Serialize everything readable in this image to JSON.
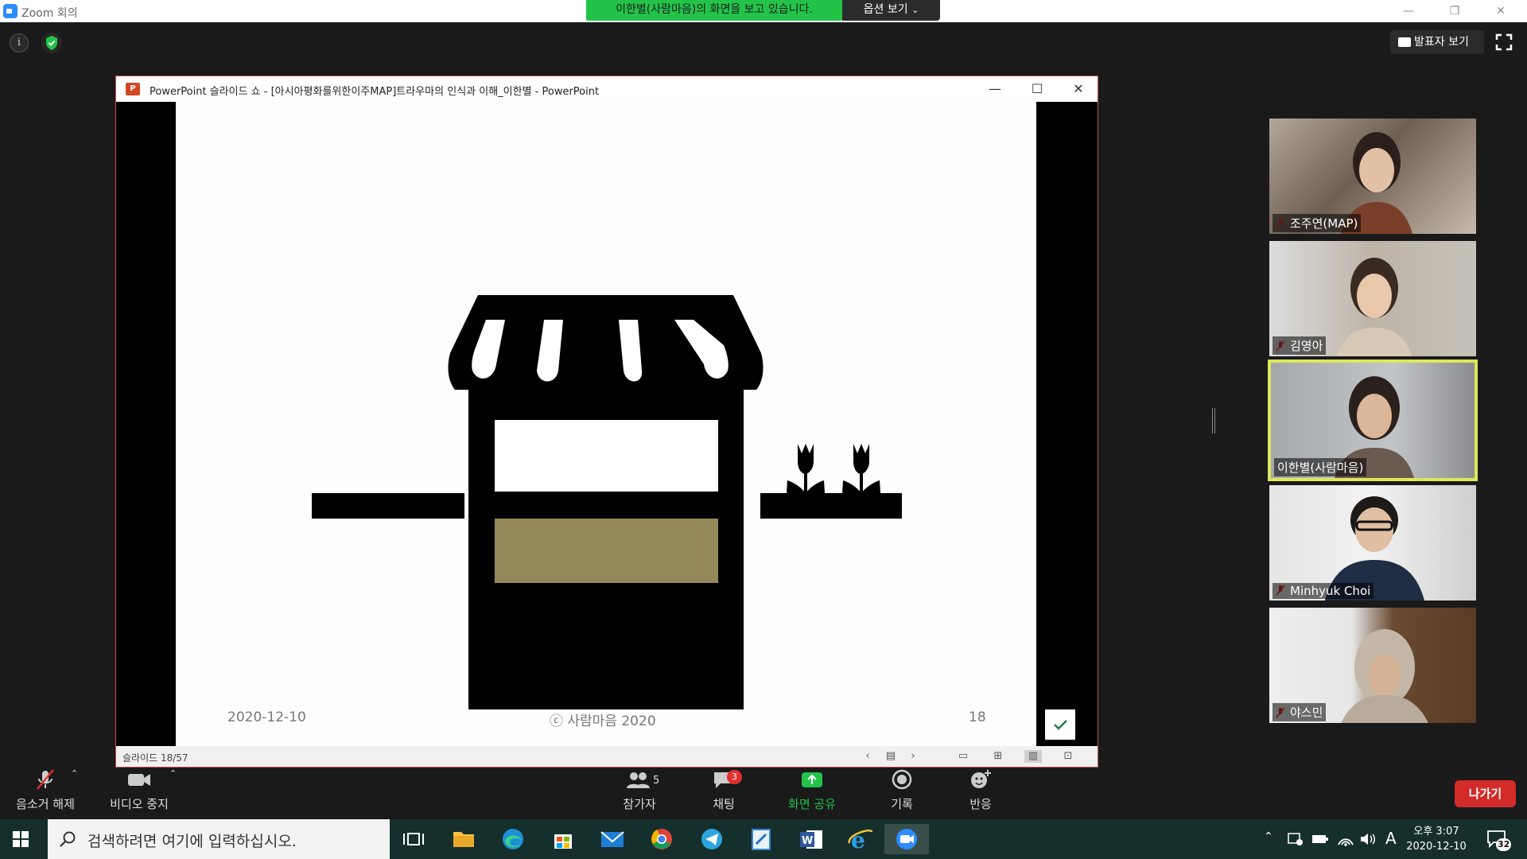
{
  "window": {
    "title": "Zoom 회의"
  },
  "share_banner": {
    "text": "이한별(사람마음)의 화면을 보고 있습니다.",
    "options_label": "옵션 보기"
  },
  "speaker_view": {
    "label": "발표자 보기"
  },
  "ppt": {
    "title": "PowerPoint 슬라이드 쇼  -  [아시아평화를위한이주MAP]트라우마의 인식과 이해_이한별 - PowerPoint",
    "status": "슬라이드 18/57",
    "slide": {
      "date": "2020-12-10",
      "copyright": "ⓒ 사람마음 2020",
      "page_number": "18"
    }
  },
  "participants": [
    {
      "name": "조주연(MAP)",
      "muted": true
    },
    {
      "name": "김영아",
      "muted": true
    },
    {
      "name": "이한별(사람마음)",
      "muted": false,
      "active_speaker": true
    },
    {
      "name": "Minhyuk Choi",
      "muted": true
    },
    {
      "name": "야스민",
      "muted": true
    }
  ],
  "controls": {
    "unmute": "음소거 해제",
    "stop_video": "비디오 중지",
    "participants": "참가자",
    "participants_count": "5",
    "chat": "채팅",
    "chat_badge": "3",
    "share_screen": "화면 공유",
    "record": "기록",
    "reactions": "반응",
    "leave": "나가기"
  },
  "taskbar": {
    "search_placeholder": "검색하려면 여기에 입력하십시오.",
    "clock_time": "오후 3:07",
    "clock_date": "2020-12-10",
    "notifications": "32",
    "ime": "A"
  },
  "colors": {
    "share_banner": "#23c34a",
    "active_speaker_border": "#dee75b",
    "leave_button": "#d32a2a",
    "stall_counter": "#958859",
    "taskbar": "#15302c"
  }
}
